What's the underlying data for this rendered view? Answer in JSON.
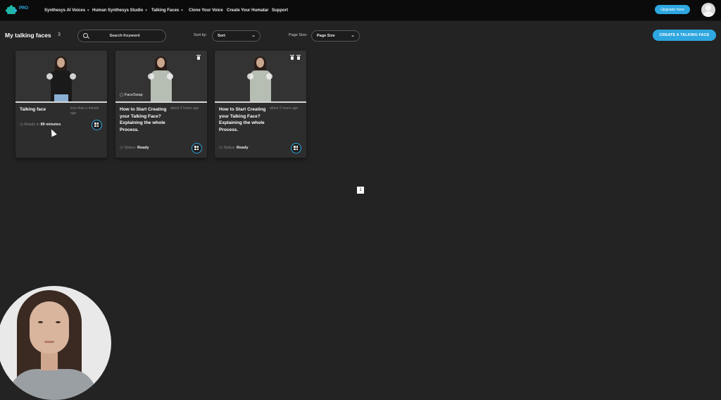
{
  "nav": {
    "logo_badge": "PRO",
    "items": [
      {
        "label": "Synthesys AI Voices",
        "caret": "▾"
      },
      {
        "label": "Human Synthesys Studio",
        "caret": "▾"
      },
      {
        "label": "Talking Faces",
        "caret": "▾"
      },
      {
        "label": "Clone Your Voice",
        "caret": ""
      },
      {
        "label": "Create Your Humatar",
        "caret": ""
      },
      {
        "label": "Support",
        "caret": ""
      }
    ],
    "upgrade_label": "Upgrade here"
  },
  "toolbar": {
    "title": "My talking faces",
    "count": "3",
    "search_placeholder": "Search Keyword",
    "sort_label": "Sort by:",
    "sort_value": "Sort",
    "page_size_label": "Page Size:",
    "page_size_value": "Page Size",
    "create_label": "CREATE A TALKING FACE"
  },
  "cards": [
    {
      "title": "Talking face",
      "time": "less than a minute ago",
      "status_label": "Ready in",
      "status_value": "89 minutes",
      "badge": ""
    },
    {
      "title": "How to Start Creating your Talking Face? Explaining the whole Process.",
      "time": "about 2 hours ago",
      "status_label": "Status:",
      "status_value": "Ready",
      "badge": "FaceSwap"
    },
    {
      "title": "How to Start Creating your Talking Face? Explaining the whole Process.",
      "time": "about 2 hours ago",
      "status_label": "Status:",
      "status_value": "Ready",
      "badge": ""
    }
  ],
  "pagination": {
    "current": "1"
  },
  "colors": {
    "accent": "#2ea7e0",
    "background": "#232323",
    "nav": "#0b0b0b",
    "card": "#2d2d2d"
  }
}
